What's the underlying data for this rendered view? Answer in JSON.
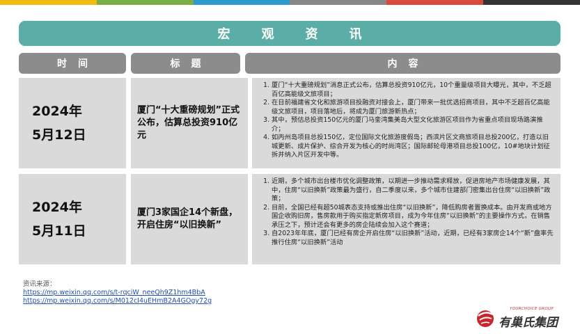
{
  "colors": {
    "top_stripes": [
      "#f2bb12",
      "#7aae47",
      "#2d9bd0",
      "#888888",
      "#da4a3a",
      "#353535"
    ],
    "banner": "#5aaea6",
    "header": "#8c8c8c",
    "cell": "#dadada"
  },
  "banner": {
    "title": "宏观资讯"
  },
  "table": {
    "headers": {
      "time": "时间",
      "title": "标题",
      "content": "内容"
    },
    "rows": [
      {
        "date_year": "2024年",
        "date_day": "5月12日",
        "title": "厦门“十大重磅规划”正式公布，估算总投资910亿元",
        "items": [
          "厦门“十大重磅规划”消息正式公布，估算总投资910亿元，10个重量级项目大曝光，其中，不乏超百亿高能级文旅项目；",
          "在日前福建省文化和旅游项目投融资对接会上，厦门带来一批优选招商项目，其中不乏超百亿高能级文旅项目，项目落地后，将成为厦门旅游新热点；",
          "其中，预估总投资150亿元的厦门马銮湾集美岛大型文化旅游区项目作为省重点项目现场路演推介；",
          "如丙州岛项目总投150亿，定位国际文化旅游度假岛；西滨片区文商旅项目总投200亿，打造以旧城更新、成片保护、综合开发为核心的时尚湾区；国际邮轮母港项目总投100亿，10#地块计划征拆并纳入片区开发中等。"
        ]
      },
      {
        "date_year": "2024年",
        "date_day": "5月11日",
        "title": "厦门3家国企14个新盘，开启住房“以旧换新”",
        "items": [
          "近期，多个城市出台楼市优化调整政策，以期进一步推动需求释放，促进房地产市场健康发展，其中，住房“以旧换新”政策最为盛行，自二季度以来，多个城市住建部门密集出台住房“以旧换新”政策；",
          "目前，全国已经有超50城表态支持或推出住房“以旧换新”，降低购房者置换成本。由开发商或地方国企收购旧房，售房款用于购买指定新房项目，成为今年住房“以旧换新”的主要操作方式，在销售承压之下，预计还会有更多的房企陆续会加入这个赛道；",
          "自2023年年底，厦门已经有房企开启住房“以旧换新”活动，近期，已经有3家房企14个“新”盘率先推行住房“以旧换新”活动"
        ]
      }
    ]
  },
  "source": {
    "label": "资讯来源：",
    "links": [
      "https://mp.weixin.qq.com/s/t-rqciW_neeQh9Z1hm4BbA",
      "https://mp.weixin.qq.com/s/M012cI4uEHmB2A4GOgy72g"
    ]
  },
  "logo": {
    "en": "YOURCHOICE GROUP",
    "cn": "有巢氏集团",
    "mark_icon": "yourchoice-logo-mark"
  }
}
